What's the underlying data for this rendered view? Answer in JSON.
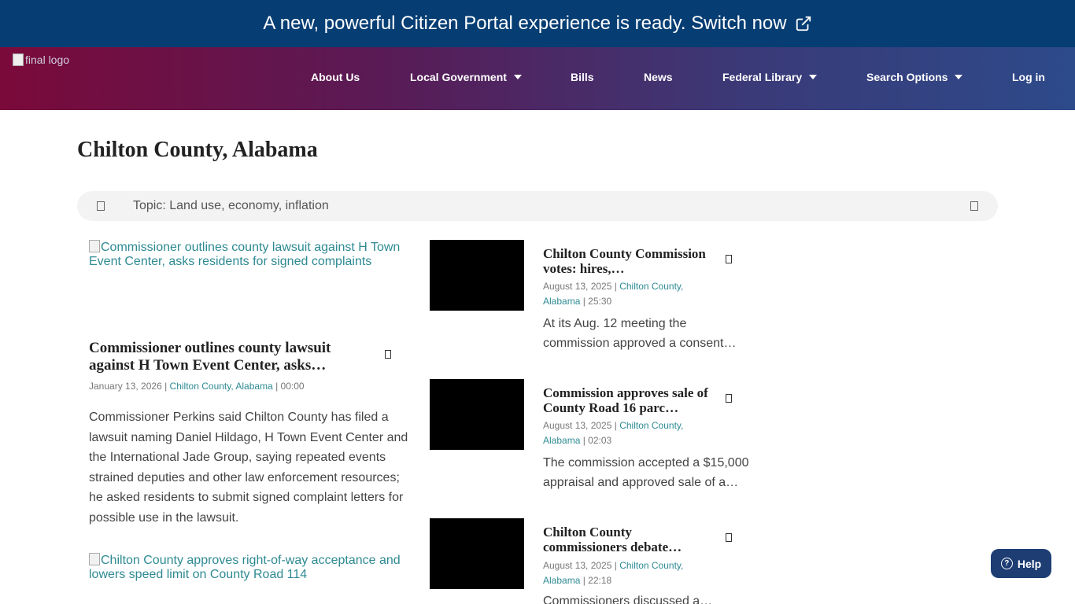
{
  "banner": {
    "text": "A new, powerful Citizen Portal experience is ready. Switch now",
    "icon": "external-link-icon"
  },
  "header": {
    "logo_alt": "final logo",
    "nav": [
      {
        "label": "About Us",
        "dropdown": false
      },
      {
        "label": "Local Government",
        "dropdown": true
      },
      {
        "label": "Bills",
        "dropdown": false
      },
      {
        "label": "News",
        "dropdown": false
      },
      {
        "label": "Federal Library",
        "dropdown": true
      },
      {
        "label": "Search Options",
        "dropdown": true
      },
      {
        "label": "Log in",
        "dropdown": false
      }
    ]
  },
  "page": {
    "title": "Chilton County, Alabama"
  },
  "topic_bar": {
    "text": "Topic: Land use, economy, inflation"
  },
  "feature": {
    "image_alt": "Commissioner outlines county lawsuit against H Town Event Center, asks residents for signed complaints",
    "title": "Commissioner outlines county lawsuit against H Town Event Center, asks…",
    "date": "January 13, 2026",
    "sep1": " | ",
    "county": "Chilton County,",
    "state": "Alabama",
    "sep2": " | ",
    "duration": "00:00",
    "description": "Commissioner Perkins said Chilton County has filed a lawsuit naming Daniel Hildago, H Town Event Center and the International Jade Group, saying repeated events strained deputies and other law enforcement resources; he asked residents to submit signed complaint letters for possible use in the lawsuit."
  },
  "second_feature": {
    "image_alt": "Chilton County approves right-of-way acceptance and lowers speed limit on County Road 114"
  },
  "cards": [
    {
      "title": "Chilton County Commission votes: hires,…",
      "date": "August 13, 2025",
      "county": "Chilton County,",
      "state": "Alabama",
      "duration": "25:30",
      "description": "At its Aug. 12 meeting the commission approved a consent…"
    },
    {
      "title": "Commission approves sale of County Road 16 parc…",
      "date": "August 13, 2025",
      "county": "Chilton County,",
      "state": "Alabama",
      "duration": "02:03",
      "description": "The commission accepted a $15,000 appraisal and approved sale of a…"
    },
    {
      "title": "Chilton County commissioners debate…",
      "date": "August 13, 2025",
      "county": "Chilton County,",
      "state": "Alabama",
      "duration": "22:18",
      "description": "Commissioners discussed a…"
    }
  ],
  "help": {
    "label": "Help",
    "icon": "question-circle-icon"
  },
  "colors": {
    "banner": "#063d73",
    "link": "#2e8a93",
    "help": "#1d3d73"
  }
}
